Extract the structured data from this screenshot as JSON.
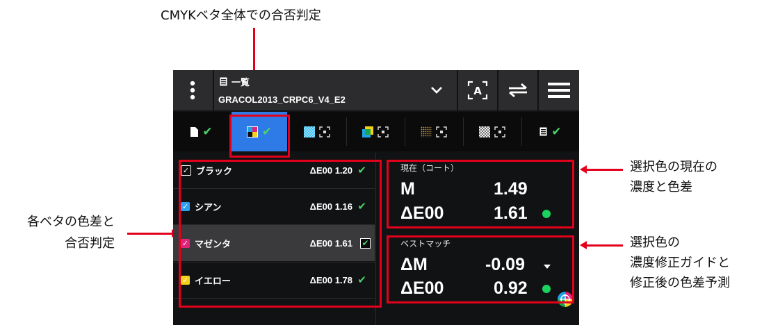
{
  "annotations": {
    "top": "CMYKベタ全体での合否判定",
    "left_line1": "各ベタの色差と",
    "left_line2": "合否判定",
    "right1_line1": "選択色の現在の",
    "right1_line2": "濃度と色差",
    "right2_line1": "選択色の",
    "right2_line2": "濃度修正ガイドと",
    "right2_line3": "修正後の色差予測"
  },
  "header": {
    "menu_icon": "vertical-dots-icon",
    "doc_label": "一覧",
    "title": "GRACOL2013_CRPC6_V4_E2"
  },
  "tabs": [
    {
      "icon": "page-icon",
      "status": "✔"
    },
    {
      "icon": "cmyk-icon",
      "status": "✔",
      "active": true
    },
    {
      "icon": "tint-pattern-icon",
      "status": "scan"
    },
    {
      "icon": "overprint-icon",
      "status": "scan"
    },
    {
      "icon": "dot-grid-icon",
      "status": "scan"
    },
    {
      "icon": "gray-pattern-icon",
      "status": "scan"
    },
    {
      "icon": "list-icon",
      "status": "✔"
    }
  ],
  "solids": [
    {
      "name": "ブラック",
      "delta": "ΔE00 1.20",
      "checkbox_color": "#111111"
    },
    {
      "name": "シアン",
      "delta": "ΔE00 1.16",
      "checkbox_color": "#2b9ff0"
    },
    {
      "name": "マゼンタ",
      "delta": "ΔE00 1.61",
      "checkbox_color": "#e0247a"
    },
    {
      "name": "イエロー",
      "delta": "ΔE00 1.78",
      "checkbox_color": "#f4d11a"
    }
  ],
  "current": {
    "label": "現在（コート）",
    "density_label": "M",
    "density_value": "1.49",
    "de_label": "ΔE00",
    "de_value": "1.61"
  },
  "best_match": {
    "label": "ベストマッチ",
    "density_label": "ΔM",
    "density_value": "-0.09",
    "de_label": "ΔE00",
    "de_value": "0.92"
  },
  "colors": {
    "annotation_red": "#e3001b",
    "pass_green": "#4bd26b",
    "active_tab": "#2e7be8"
  }
}
